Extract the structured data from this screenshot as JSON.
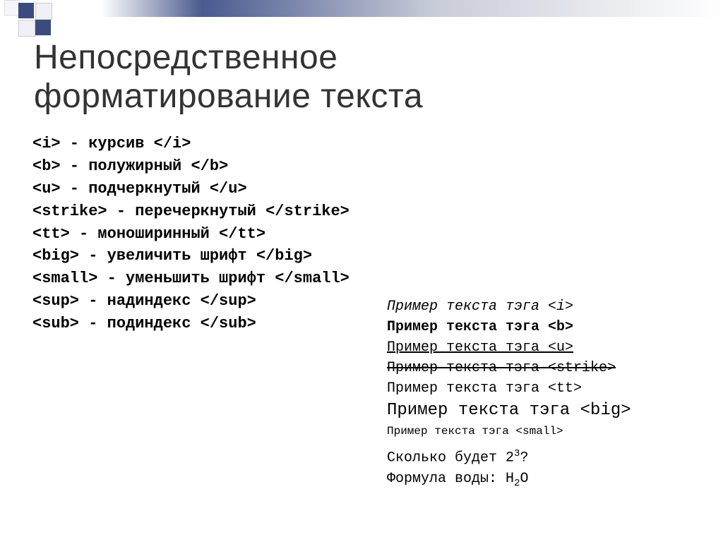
{
  "heading_line1": "Непосредственное",
  "heading_line2": "форматирование текста",
  "tags": {
    "i": {
      "open": "<i>",
      "desc": " - курсив ",
      "close": "</i>"
    },
    "b": {
      "open": "<b>",
      "desc": " - полужирный ",
      "close": "</b>"
    },
    "u": {
      "open": "<u>",
      "desc": " - подчеркнутый ",
      "close": "</u>"
    },
    "strike": {
      "open": "<strike>",
      "desc": " - перечеркнутый ",
      "close": "</strike>"
    },
    "tt": {
      "open": "<tt>",
      "desc": " - моноширинный ",
      "close": "</tt>"
    },
    "big": {
      "open": "<big>",
      "desc": " - увеличить шрифт ",
      "close": "</big>"
    },
    "small": {
      "open": "<small>",
      "desc": " - уменьшить шрифт ",
      "close": "</small>"
    },
    "sup": {
      "open": "<sup>",
      "desc": " - надиндекс ",
      "close": "</sup>"
    },
    "sub": {
      "open": "<sub>",
      "desc": " - подиндекс ",
      "close": "</sub>"
    }
  },
  "examples": {
    "i": "Пример текста тэга <i>",
    "b": "Пример текста тэга <b>",
    "u": "Пример текста тэга <u>",
    "s": "Пример текста тэга <strike>",
    "tt": "Пример текста тэга <tt>",
    "big": "Пример текста тэга <big>",
    "small": "Пример текста тэга <small>"
  },
  "question_prefix": "Сколько будет 2",
  "question_exp": "3",
  "question_suffix": "?",
  "formula_prefix": "Формула воды: H",
  "formula_sub": "2",
  "formula_suffix": "O"
}
